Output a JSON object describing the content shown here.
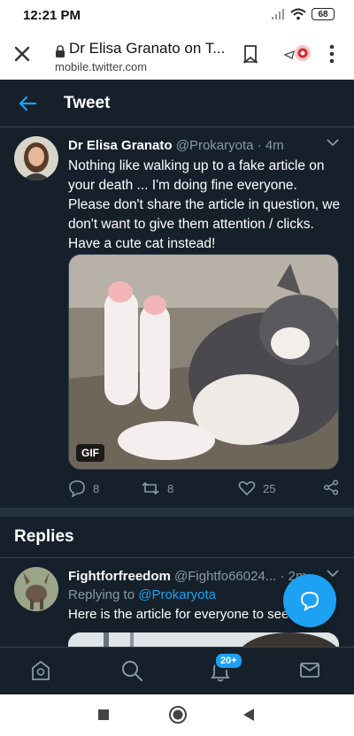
{
  "status_bar": {
    "time": "12:21 PM",
    "battery": "68"
  },
  "browser": {
    "title": "Dr Elisa Granato on T...",
    "url": "mobile.twitter.com"
  },
  "header": {
    "title": "Tweet"
  },
  "tweet": {
    "author_name": "Dr Elisa Granato",
    "author_handle": "@Prokaryota",
    "time": "4m",
    "text": "Nothing like walking up to a fake article on your death ... I'm doing fine everyone. Please don't share the article in question, we don't want to give them attention / clicks. Have a cute cat instead!",
    "media_badge": "GIF",
    "replies_count": "8",
    "retweets_count": "8",
    "likes_count": "25"
  },
  "replies_section": {
    "title": "Replies"
  },
  "reply": {
    "author_name": "Fightforfreedom",
    "author_handle": "@Fightfo66024...",
    "time": "2m",
    "replying_to_label": "Replying to",
    "replying_to_handle": "@Prokaryota",
    "text": "Here is the article for everyone to see"
  },
  "bottom_nav": {
    "notifications_badge": "20+"
  },
  "colors": {
    "background": "#15202b",
    "accent": "#1da1f2",
    "muted": "#8899a6"
  }
}
